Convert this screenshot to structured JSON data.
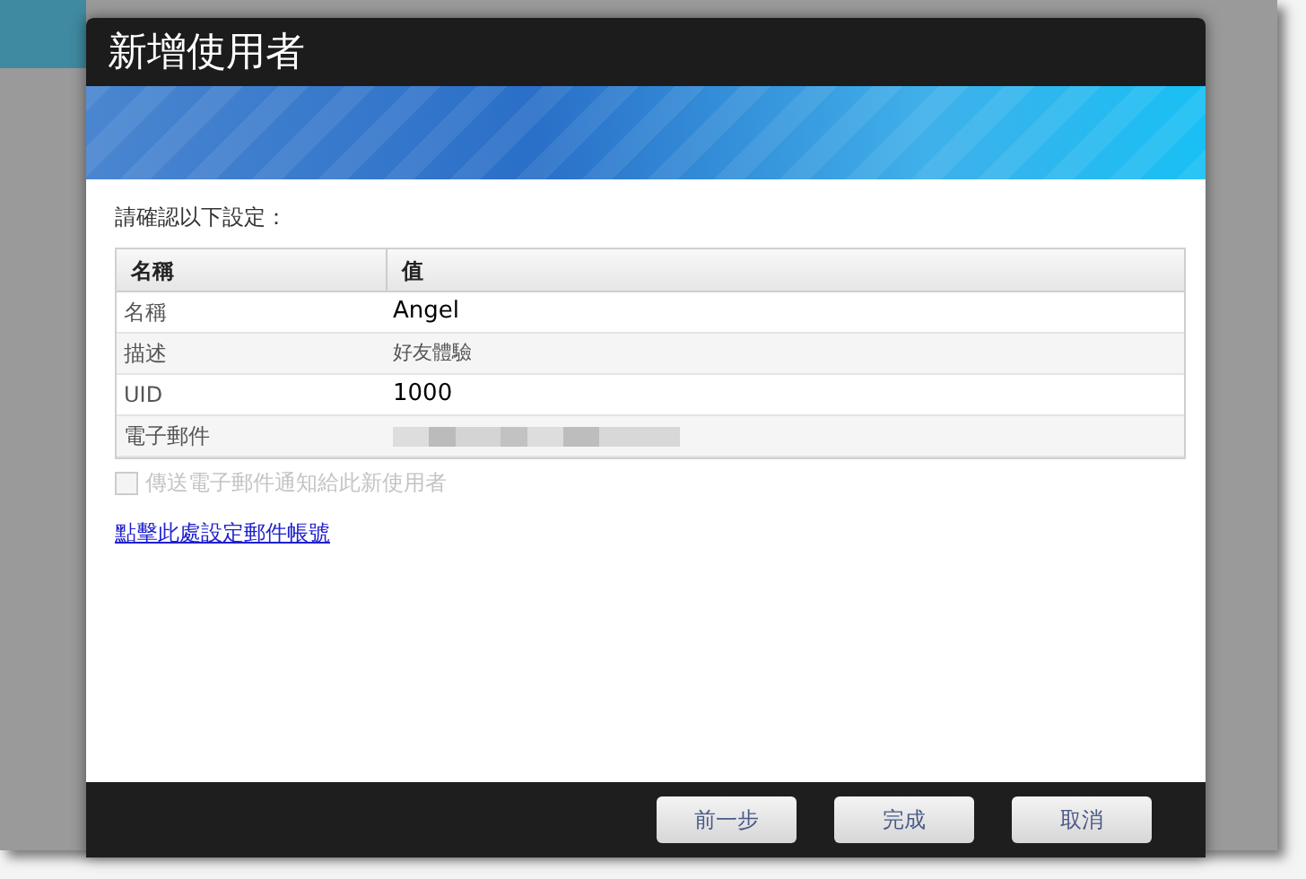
{
  "dialog": {
    "title": "新增使用者",
    "prompt": "請確認以下設定：",
    "table": {
      "columns": [
        "名稱",
        "值"
      ],
      "rows": [
        {
          "kind": "text",
          "name": "名稱",
          "value": "Angel",
          "bold": true
        },
        {
          "kind": "text",
          "name": "描述",
          "value": "好友體驗",
          "bold": false
        },
        {
          "kind": "text",
          "name": "UID",
          "value": "1000",
          "bold": true
        },
        {
          "kind": "redacted",
          "name": "電子郵件"
        }
      ]
    },
    "notify_checkbox": {
      "label": "傳送電子郵件通知給此新使用者",
      "checked": false,
      "disabled": true
    },
    "link": "點擊此處設定郵件帳號",
    "buttons": [
      "前一步",
      "完成",
      "取消"
    ]
  }
}
